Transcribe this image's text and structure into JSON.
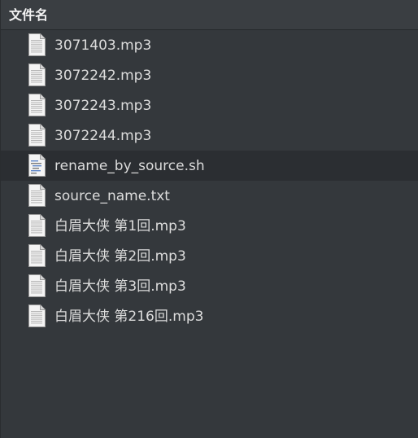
{
  "header": {
    "column_label": "文件名"
  },
  "files": [
    {
      "name": "3071403.mp3",
      "icon": "audio-file-icon"
    },
    {
      "name": "3072242.mp3",
      "icon": "audio-file-icon"
    },
    {
      "name": "3072243.mp3",
      "icon": "audio-file-icon"
    },
    {
      "name": "3072244.mp3",
      "icon": "audio-file-icon"
    },
    {
      "name": "rename_by_source.sh",
      "icon": "script-file-icon"
    },
    {
      "name": "source_name.txt",
      "icon": "text-file-icon"
    },
    {
      "name": "白眉大侠 第1回.mp3",
      "icon": "audio-file-icon"
    },
    {
      "name": "白眉大侠 第2回.mp3",
      "icon": "audio-file-icon"
    },
    {
      "name": "白眉大侠 第3回.mp3",
      "icon": "audio-file-icon"
    },
    {
      "name": "白眉大侠 第216回.mp3",
      "icon": "audio-file-icon"
    }
  ],
  "colors": {
    "background": "#34383c",
    "header_background": "#3a3e42",
    "selected_row": "#2b2e32",
    "text": "#dcdcdc"
  }
}
